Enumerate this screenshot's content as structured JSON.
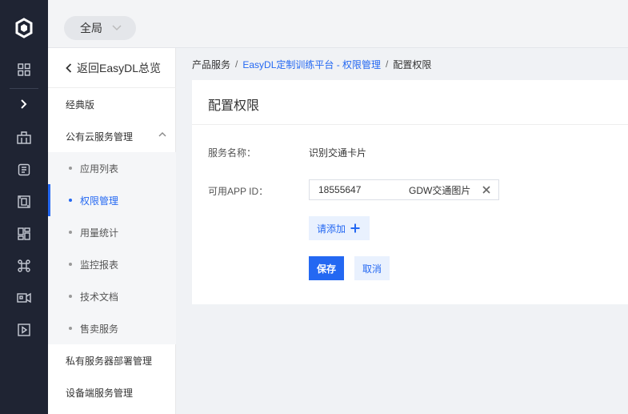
{
  "topbar": {
    "scope_label": "全局",
    "scope_icon": "chevron-down-icon"
  },
  "rail": {
    "logo_icon": "cube-logo-icon",
    "items": [
      "grid-icon",
      "chevron-right-icon",
      "building-icon",
      "document-list-icon",
      "frame-icon",
      "dashboard-icon",
      "command-icon",
      "camera-icon",
      "play-icon"
    ]
  },
  "sidebar": {
    "back_label": "返回EasyDL总览",
    "classic_label": "经典版",
    "group_label": "公有云服务管理",
    "sub_items": [
      {
        "label": "应用列表",
        "active": false
      },
      {
        "label": "权限管理",
        "active": true
      },
      {
        "label": "用量统计",
        "active": false
      },
      {
        "label": "监控报表",
        "active": false
      },
      {
        "label": "技术文档",
        "active": false
      },
      {
        "label": "售卖服务",
        "active": false
      }
    ],
    "private_label": "私有服务器部署管理",
    "device_label": "设备端服务管理"
  },
  "breadcrumb": {
    "root": "产品服务",
    "sep": "/",
    "parent": "EasyDL定制训练平台 - 权限管理",
    "current": "配置权限"
  },
  "card": {
    "title": "配置权限",
    "service_label": "服务名称：",
    "service_value": "识别交通卡片",
    "appid_label": "可用APP ID：",
    "app_id": "18555647",
    "app_name": "GDW交通图片",
    "add_label": "请添加",
    "save_label": "保存",
    "cancel_label": "取消"
  },
  "colors": {
    "accent": "#2468f2",
    "rail_bg": "#1f2433",
    "accent_light": "#e9f1fe"
  }
}
